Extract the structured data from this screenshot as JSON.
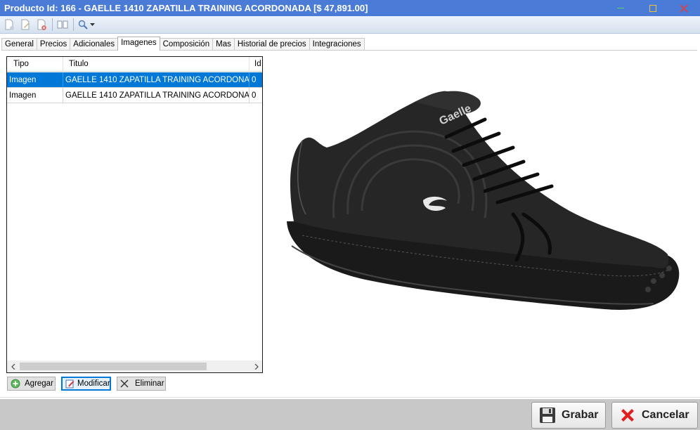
{
  "window": {
    "title": "Producto Id: 166 - GAELLE 1410 ZAPATILLA TRAINING ACORDONADA [$ 47,891.00]",
    "title_bar_color": "#4a7bd6"
  },
  "toolbar": {
    "icons": [
      "new-document-icon",
      "edit-document-icon",
      "delete-document-icon",
      "book-icon",
      "search-icon"
    ]
  },
  "tabs": [
    {
      "label": "General"
    },
    {
      "label": "Precios"
    },
    {
      "label": "Adicionales"
    },
    {
      "label": "Imagenes",
      "active": true
    },
    {
      "label": "Composición"
    },
    {
      "label": "Mas"
    },
    {
      "label": "Historial de precios"
    },
    {
      "label": "Integraciones"
    }
  ],
  "grid": {
    "columns": [
      "Tipo",
      "Titulo",
      "Id"
    ],
    "rows": [
      {
        "tipo": "Imagen",
        "titulo": "GAELLE 1410 ZAPATILLA TRAINING ACORDONA...",
        "id": "0",
        "selected": true
      },
      {
        "tipo": "Imagen",
        "titulo": "GAELLE 1410 ZAPATILLA TRAINING ACORDONA...",
        "id": "0",
        "selected": false
      }
    ],
    "selection_color": "#0078d7"
  },
  "actions": {
    "agregar": "Agregar",
    "modificar": "Modificar",
    "eliminar": "Eliminar"
  },
  "preview": {
    "brand_text": "Gaelle"
  },
  "footer": {
    "grabar": "Grabar",
    "cancelar": "Cancelar"
  }
}
